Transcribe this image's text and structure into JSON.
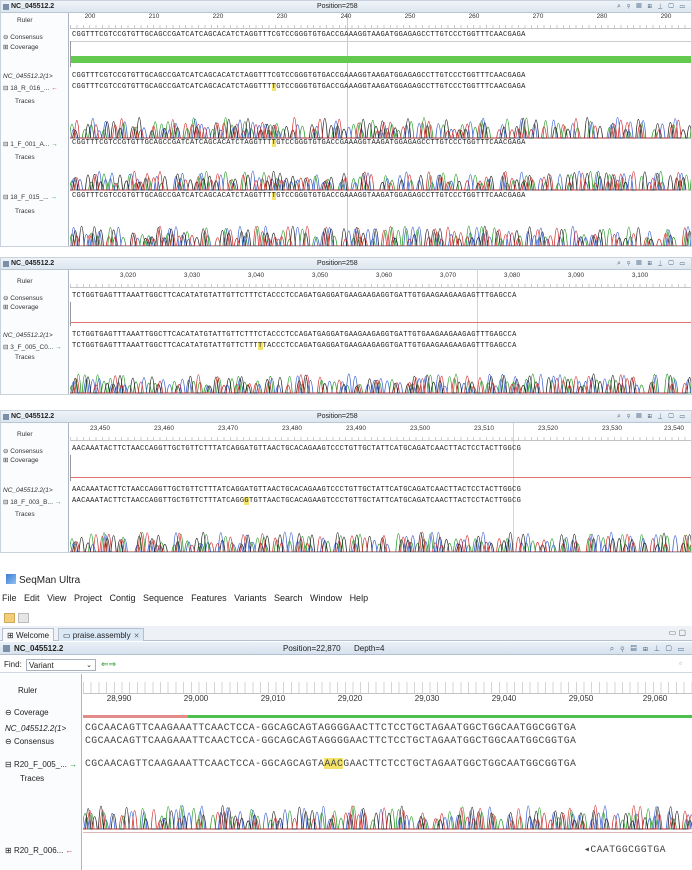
{
  "panels": [
    {
      "title": "NC_045512.2",
      "position": "Position=258",
      "ticks": [
        "200",
        "210",
        "220",
        "230",
        "240",
        "250",
        "260",
        "270",
        "280",
        "290"
      ],
      "labels": {
        "ruler": "Ruler",
        "consensus": "Consensus",
        "coverage": "Coverage",
        "ref": "NC_045512.2(1>",
        "reads": [
          "18_R_016_...",
          "1_F_001_A...",
          "18_F_015_..."
        ],
        "traces": "Traces"
      },
      "consensus_seq": "CGGTTTCGTCCGTGTTGCAGCCGATCATCAGCACATCTAGGTTTCGTCCGGGTGTGACCGAAAGGTAAGATGGAGAGCCTTGTCCCTGGTTTCAACGAGA",
      "ref_seq": "CGGTTTCGTCCGTGTTGCAGCCGATCATCAGCACATCTAGGTTTCGTCCGGGTGTGACCGAAAGGTAAGATGGAGAGCCTTGTCCCTGGTTTCAACGAGA",
      "reads_seq": [
        {
          "pre": "CGGTTTCGTCCGTGTTGCAGCCGATCATCAGCACATCTAGGTTT",
          "hl": "T",
          "post": "GTCCGGGTGTGACCGAAAGGTAAGATGGAGAGCCTTGTCCCTGGTTTCAACGAGA"
        },
        {
          "pre": "CGGTTTCGTCCGTGTTGCAGCCGATCATCAGCACATCTAGGTTT",
          "hl": "T",
          "post": "GTCCGGGTGTGACCGAAAGGTAAGATGGAGAGCCTTGTCCCTGGTTTCAACGAGA"
        },
        {
          "pre": "CGGTTTCGTCCGTGTTGCAGCCGATCATCAGCACATCTAGGTTT",
          "hl": "T",
          "post": "GTCCGGGTGTGACCGAAAGGTAAGATGGAGAGCCTTGTCCCTGGTTTCAACGAGA"
        }
      ]
    },
    {
      "title": "NC_045512.2",
      "position": "Position=258",
      "ticks": [
        "3,020",
        "3,030",
        "3,040",
        "3,050",
        "3,060",
        "3,070",
        "3,080",
        "3,090",
        "3,100"
      ],
      "labels": {
        "ruler": "Ruler",
        "consensus": "Consensus",
        "coverage": "Coverage",
        "ref": "NC_045512.2(1>",
        "reads": [
          "3_F_005_C0..."
        ],
        "traces": "Traces"
      },
      "consensus_seq": "TCTGGTGAGTTTAAATTGGCTTCACATATGTATTGTTCTTTCTACCCTCCAGATGAGGATGAAGAAGAGGTGATTGTGAAGAAGAAGAGTTTGAGCCA",
      "ref_seq": "TCTGGTGAGTTTAAATTGGCTTCACATATGTATTGTTCTTTCTACCCTCCAGATGAGGATGAAGAAGAGGTGATTGTGAAGAAGAAGAGTTTGAGCCA",
      "reads_seq": [
        {
          "pre": "TCTGGTGAGTTTAAATTGGCTTCACATATGTATTGTTCTTT",
          "hl": "T",
          "post": "TACCCTCCAGATGAGGATGAAGAAGAGGTGATTGTGAAGAAGAAGAGTTTGAGCCA"
        }
      ]
    },
    {
      "title": "NC_045512.2",
      "position": "Position=258",
      "ticks": [
        "23,450",
        "23,460",
        "23,470",
        "23,480",
        "23,490",
        "23,500",
        "23,510",
        "23,520",
        "23,530",
        "23,540"
      ],
      "labels": {
        "ruler": "Ruler",
        "consensus": "Consensus",
        "coverage": "Coverage",
        "ref": "NC_045512.2(1>",
        "reads": [
          "18_F_003_B..."
        ],
        "traces": "Traces"
      },
      "consensus_seq": "AACAAATACTTCTAACCAGGTTGCTGTTCTTTATCAGGATGTTAACTGCACAGAAGTCCCTGTTGCTATTCATGCAGATCAACTTACTCCTACTTGGCG",
      "ref_seq": "AACAAATACTTCTAACCAGGTTGCTGTTCTTTATCAGGATGTTAACTGCACAGAAGTCCCTGTTGCTATTCATGCAGATCAACTTACTCCTACTTGGCG",
      "reads_seq": [
        {
          "pre": "AACAAATACTTCTAACCAGGTTGCTGTTCTTTATCAGG",
          "hl": "G",
          "post": "TGTTAACTGCACAGAAGTCCCTGTTGCTATTCATGCAGATCAACTTACTCCTACTTGGCG"
        }
      ]
    }
  ],
  "app": {
    "title": "SeqMan Ultra",
    "menu": [
      "File",
      "Edit",
      "View",
      "Project",
      "Contig",
      "Sequence",
      "Features",
      "Variants",
      "Search",
      "Window",
      "Help"
    ],
    "tabs": [
      "Welcome",
      "praise.assembly"
    ],
    "contig_title": "NC_045512.2",
    "position": "Position=22,870",
    "depth": "Depth=4",
    "find_label": "Find:",
    "find_value": "Variant",
    "ticks": [
      "28,990",
      "29,000",
      "29,010",
      "29,020",
      "29,030",
      "29,040",
      "29,050",
      "29,060"
    ],
    "labels": {
      "ruler": "Ruler",
      "coverage": "Coverage",
      "ref": "NC_045512.2(1>",
      "consensus": "Consensus",
      "read1": "R20_F_005_...",
      "traces": "Traces",
      "read2": "R20_R_006..."
    },
    "ref_seq": "CGCAACAGTTCAAGAAATTCAACTCCA-GGCAGCAGTAGGGGAACTTCTCCTGCTAGAATGGCTGGCAATGGCGGTGA",
    "consensus_seq": "CGCAACAGTTCAAGAAATTCAACTCCA-GGCAGCAGTAGGGGAACTTCTCCTGCTAGAATGGCTGGCAATGGCGGTGA",
    "read1_pre": "CGCAACAGTTCAAGAAATTCAACTCCA-GGCAGCAGTA",
    "read1_hl": "AAC",
    "read1_post": "GAACTTCTCCTGCTAGAATGGCTGGCAATGGCGGTGA",
    "read2_seq": "CAATGGCGGTGA"
  }
}
